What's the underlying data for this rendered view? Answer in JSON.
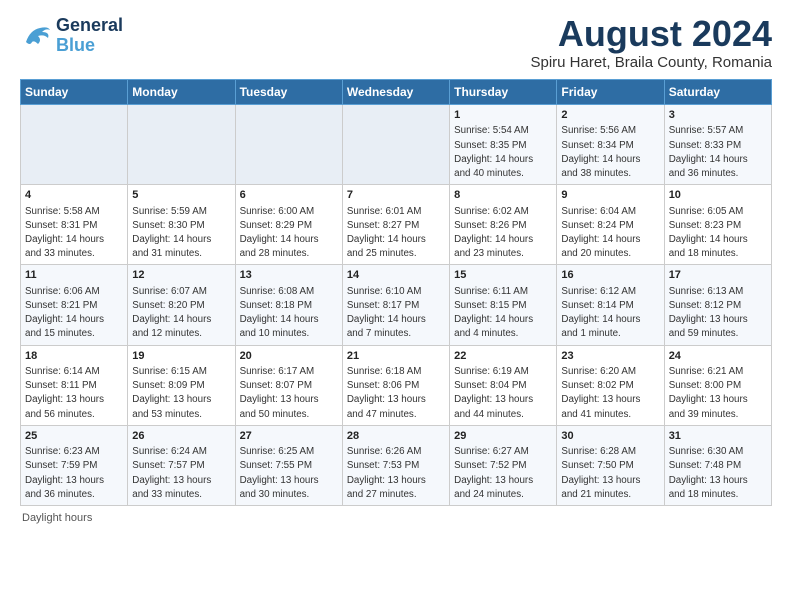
{
  "header": {
    "logo_line1": "General",
    "logo_line2": "Blue",
    "title": "August 2024",
    "subtitle": "Spiru Haret, Braila County, Romania"
  },
  "weekdays": [
    "Sunday",
    "Monday",
    "Tuesday",
    "Wednesday",
    "Thursday",
    "Friday",
    "Saturday"
  ],
  "footer": "Daylight hours",
  "weeks": [
    [
      {
        "day": "",
        "info": ""
      },
      {
        "day": "",
        "info": ""
      },
      {
        "day": "",
        "info": ""
      },
      {
        "day": "",
        "info": ""
      },
      {
        "day": "1",
        "info": "Sunrise: 5:54 AM\nSunset: 8:35 PM\nDaylight: 14 hours\nand 40 minutes."
      },
      {
        "day": "2",
        "info": "Sunrise: 5:56 AM\nSunset: 8:34 PM\nDaylight: 14 hours\nand 38 minutes."
      },
      {
        "day": "3",
        "info": "Sunrise: 5:57 AM\nSunset: 8:33 PM\nDaylight: 14 hours\nand 36 minutes."
      }
    ],
    [
      {
        "day": "4",
        "info": "Sunrise: 5:58 AM\nSunset: 8:31 PM\nDaylight: 14 hours\nand 33 minutes."
      },
      {
        "day": "5",
        "info": "Sunrise: 5:59 AM\nSunset: 8:30 PM\nDaylight: 14 hours\nand 31 minutes."
      },
      {
        "day": "6",
        "info": "Sunrise: 6:00 AM\nSunset: 8:29 PM\nDaylight: 14 hours\nand 28 minutes."
      },
      {
        "day": "7",
        "info": "Sunrise: 6:01 AM\nSunset: 8:27 PM\nDaylight: 14 hours\nand 25 minutes."
      },
      {
        "day": "8",
        "info": "Sunrise: 6:02 AM\nSunset: 8:26 PM\nDaylight: 14 hours\nand 23 minutes."
      },
      {
        "day": "9",
        "info": "Sunrise: 6:04 AM\nSunset: 8:24 PM\nDaylight: 14 hours\nand 20 minutes."
      },
      {
        "day": "10",
        "info": "Sunrise: 6:05 AM\nSunset: 8:23 PM\nDaylight: 14 hours\nand 18 minutes."
      }
    ],
    [
      {
        "day": "11",
        "info": "Sunrise: 6:06 AM\nSunset: 8:21 PM\nDaylight: 14 hours\nand 15 minutes."
      },
      {
        "day": "12",
        "info": "Sunrise: 6:07 AM\nSunset: 8:20 PM\nDaylight: 14 hours\nand 12 minutes."
      },
      {
        "day": "13",
        "info": "Sunrise: 6:08 AM\nSunset: 8:18 PM\nDaylight: 14 hours\nand 10 minutes."
      },
      {
        "day": "14",
        "info": "Sunrise: 6:10 AM\nSunset: 8:17 PM\nDaylight: 14 hours\nand 7 minutes."
      },
      {
        "day": "15",
        "info": "Sunrise: 6:11 AM\nSunset: 8:15 PM\nDaylight: 14 hours\nand 4 minutes."
      },
      {
        "day": "16",
        "info": "Sunrise: 6:12 AM\nSunset: 8:14 PM\nDaylight: 14 hours\nand 1 minute."
      },
      {
        "day": "17",
        "info": "Sunrise: 6:13 AM\nSunset: 8:12 PM\nDaylight: 13 hours\nand 59 minutes."
      }
    ],
    [
      {
        "day": "18",
        "info": "Sunrise: 6:14 AM\nSunset: 8:11 PM\nDaylight: 13 hours\nand 56 minutes."
      },
      {
        "day": "19",
        "info": "Sunrise: 6:15 AM\nSunset: 8:09 PM\nDaylight: 13 hours\nand 53 minutes."
      },
      {
        "day": "20",
        "info": "Sunrise: 6:17 AM\nSunset: 8:07 PM\nDaylight: 13 hours\nand 50 minutes."
      },
      {
        "day": "21",
        "info": "Sunrise: 6:18 AM\nSunset: 8:06 PM\nDaylight: 13 hours\nand 47 minutes."
      },
      {
        "day": "22",
        "info": "Sunrise: 6:19 AM\nSunset: 8:04 PM\nDaylight: 13 hours\nand 44 minutes."
      },
      {
        "day": "23",
        "info": "Sunrise: 6:20 AM\nSunset: 8:02 PM\nDaylight: 13 hours\nand 41 minutes."
      },
      {
        "day": "24",
        "info": "Sunrise: 6:21 AM\nSunset: 8:00 PM\nDaylight: 13 hours\nand 39 minutes."
      }
    ],
    [
      {
        "day": "25",
        "info": "Sunrise: 6:23 AM\nSunset: 7:59 PM\nDaylight: 13 hours\nand 36 minutes."
      },
      {
        "day": "26",
        "info": "Sunrise: 6:24 AM\nSunset: 7:57 PM\nDaylight: 13 hours\nand 33 minutes."
      },
      {
        "day": "27",
        "info": "Sunrise: 6:25 AM\nSunset: 7:55 PM\nDaylight: 13 hours\nand 30 minutes."
      },
      {
        "day": "28",
        "info": "Sunrise: 6:26 AM\nSunset: 7:53 PM\nDaylight: 13 hours\nand 27 minutes."
      },
      {
        "day": "29",
        "info": "Sunrise: 6:27 AM\nSunset: 7:52 PM\nDaylight: 13 hours\nand 24 minutes."
      },
      {
        "day": "30",
        "info": "Sunrise: 6:28 AM\nSunset: 7:50 PM\nDaylight: 13 hours\nand 21 minutes."
      },
      {
        "day": "31",
        "info": "Sunrise: 6:30 AM\nSunset: 7:48 PM\nDaylight: 13 hours\nand 18 minutes."
      }
    ]
  ]
}
